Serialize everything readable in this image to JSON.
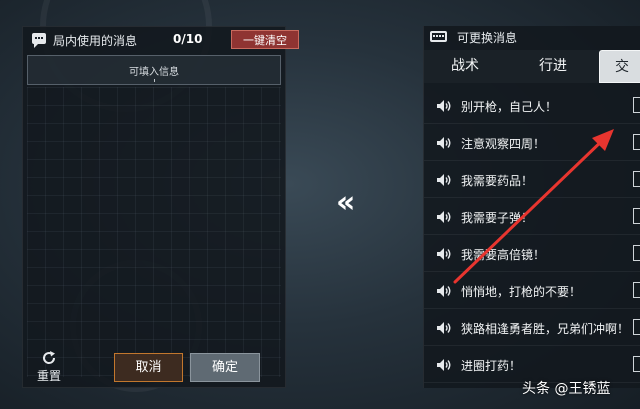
{
  "left_panel": {
    "title": "局内使用的消息",
    "count": "0/10",
    "clear_label": "一键清空",
    "input_placeholder": "可填入信息",
    "reset_label": "重置",
    "cancel_label": "取消",
    "confirm_label": "确定"
  },
  "transfer_icon": "«",
  "right_panel": {
    "title": "可更换消息",
    "tabs": [
      {
        "label": "战术",
        "active": false
      },
      {
        "label": "行进",
        "active": false
      },
      {
        "label": "交",
        "active": true
      }
    ],
    "messages": [
      {
        "text": "别开枪，自己人！"
      },
      {
        "text": "注意观察四周！"
      },
      {
        "text": "我需要药品！"
      },
      {
        "text": "我需要子弹！"
      },
      {
        "text": "我需要高倍镜！"
      },
      {
        "text": "悄悄地，打枪的不要！"
      },
      {
        "text": "狭路相逢勇者胜，兄弟们冲啊！"
      },
      {
        "text": "进圈打药！"
      }
    ]
  },
  "watermark": "头条 @王锈蓝",
  "icons": [
    "chat-icon",
    "keyboard-icon",
    "speaker-icon",
    "refresh-icon",
    "double-chevron-left-icon",
    "red-arrow-annotation"
  ],
  "colors": {
    "clear_button": "#8f3432",
    "cancel_border": "#c2772d",
    "confirm_button": "#5f6a73",
    "annotation_arrow": "#e8352f"
  }
}
